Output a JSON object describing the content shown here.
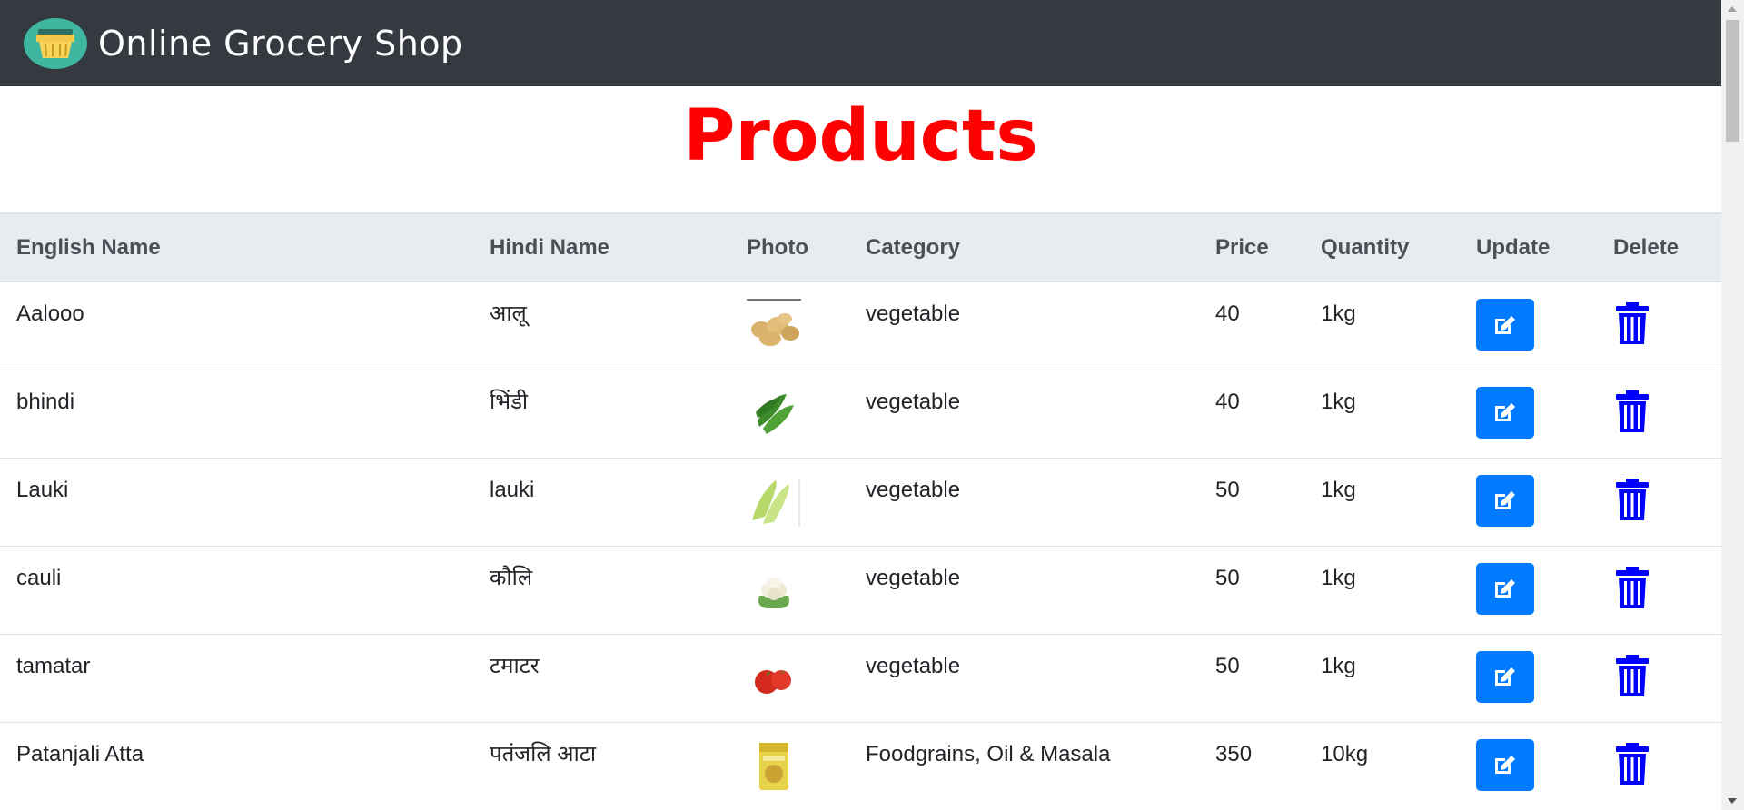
{
  "header": {
    "brand": "Online Grocery Shop",
    "logo_icon": "basket-icon"
  },
  "page": {
    "title": "Products"
  },
  "table": {
    "columns": [
      "English Name",
      "Hindi Name",
      "Photo",
      "Category",
      "Price",
      "Quantity",
      "Update",
      "Delete"
    ],
    "rows": [
      {
        "english": "Aalooo",
        "hindi": "आलू",
        "photo": "potato-image",
        "category": "vegetable",
        "price": "40",
        "quantity": "1kg"
      },
      {
        "english": "bhindi",
        "hindi": "भिंडी",
        "photo": "okra-image",
        "category": "vegetable",
        "price": "40",
        "quantity": "1kg"
      },
      {
        "english": "Lauki",
        "hindi": "lauki",
        "photo": "bottle-gourd-image",
        "category": "vegetable",
        "price": "50",
        "quantity": "1kg"
      },
      {
        "english": "cauli",
        "hindi": "कौलि",
        "photo": "cauliflower-image",
        "category": "vegetable",
        "price": "50",
        "quantity": "1kg"
      },
      {
        "english": "tamatar",
        "hindi": "टमाटर",
        "photo": "tomato-image",
        "category": "vegetable",
        "price": "50",
        "quantity": "1kg"
      },
      {
        "english": "Patanjali Atta",
        "hindi": "पतंजलि आटा",
        "photo": "flour-pack-image",
        "category": "Foodgrains, Oil & Masala",
        "price": "350",
        "quantity": "10kg"
      }
    ],
    "update_icon": "edit-icon",
    "delete_icon": "trash-icon"
  },
  "colors": {
    "navbar": "#343a40",
    "title": "#ff0000",
    "update_button": "#007bff",
    "delete_icon": "#0000ff",
    "table_header": "#e9ecef"
  }
}
